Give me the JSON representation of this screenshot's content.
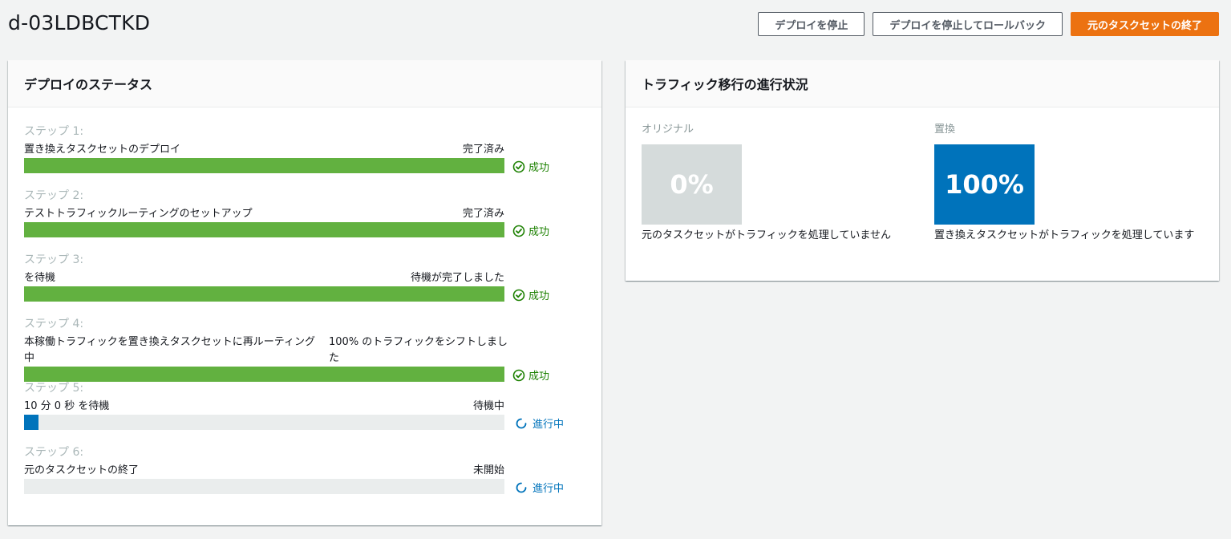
{
  "page": {
    "title": "d-03LDBCTKD"
  },
  "actions": {
    "stop_label": "デプロイを停止",
    "stop_rollback_label": "デプロイを停止してロールバック",
    "terminate_label": "元のタスクセットの終了"
  },
  "status_panel": {
    "title": "デプロイのステータス",
    "steps": [
      {
        "label": "ステップ 1:",
        "name": "置き換えタスクセットのデプロイ",
        "state": "完了済み",
        "progress": 1.0,
        "outcome": "成功",
        "outcome_type": "success"
      },
      {
        "label": "ステップ 2:",
        "name": "テストトラフィックルーティングのセットアップ",
        "state": "完了済み",
        "progress": 1.0,
        "outcome": "成功",
        "outcome_type": "success"
      },
      {
        "label": "ステップ 3:",
        "name": "を待機",
        "state": "待機が完了しました",
        "progress": 1.0,
        "outcome": "成功",
        "outcome_type": "success"
      },
      {
        "label": "ステップ 4:",
        "name": "本稼働トラフィックを置き換えタスクセットに再ルーティング中",
        "state": "100% のトラフィックをシフトしました",
        "progress": 1.0,
        "outcome": "成功",
        "outcome_type": "success"
      },
      {
        "label": "ステップ 5:",
        "name": "10 分 0 秒 を待機",
        "state": "待機中",
        "progress": 0.03,
        "outcome": "進行中",
        "outcome_type": "progress"
      },
      {
        "label": "ステップ 6:",
        "name": "元のタスクセットの終了",
        "state": "未開始",
        "progress": 0.0,
        "outcome": "進行中",
        "outcome_type": "progress"
      }
    ]
  },
  "traffic_panel": {
    "title": "トラフィック移行の進行状況",
    "original": {
      "label": "オリジナル",
      "percent": "0%",
      "description": "元のタスクセットがトラフィックを処理していません",
      "color": "#d5dbdb"
    },
    "replacement": {
      "label": "置換",
      "percent": "100%",
      "description": "置き換えタスクセットがトラフィックを処理しています",
      "color": "#0073bb"
    }
  },
  "colors": {
    "success": "#1d8102",
    "progress": "#0073bb",
    "bar_success": "#62b140",
    "bar_progress": "#0073bb",
    "primary_button": "#ec7211"
  }
}
